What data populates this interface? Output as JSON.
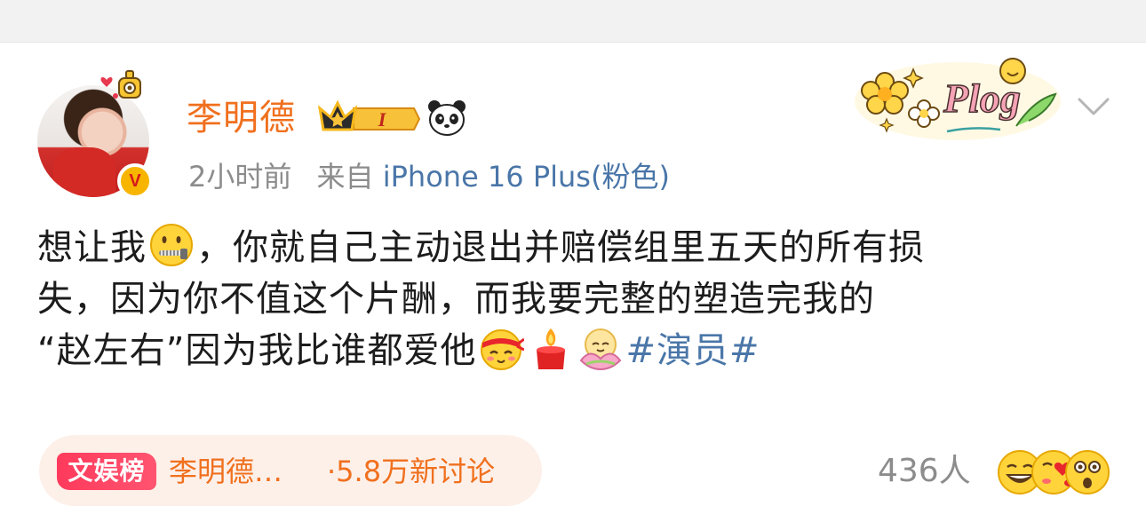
{
  "post": {
    "username": "李明德",
    "member_level": "I",
    "verified_mark": "V",
    "time": "2小时前",
    "source_prefix": "来自",
    "source_device": "iPhone 16 Plus(粉色)",
    "content_line1_a": "想让我",
    "content_line1_b": "，你就自己主动退出并赔偿组里五天的所有损",
    "content_line2": "失，因为你不值这个片酬，而我要完整的塑造完我的",
    "content_line3_a": "“赵左右”因为我比谁都爱他",
    "topic": "#演员#",
    "sticker_text": "Plog"
  },
  "rank": {
    "tag": "文娱榜",
    "name": "李明德…",
    "count": "·5.8万新讨论"
  },
  "footer": {
    "people": "436人"
  },
  "icons": {
    "avatar_deco": "heart-robot-icon",
    "crown": "crown-icon",
    "panda": "panda-icon",
    "chevron": "chevron-down-icon",
    "emoji_zipper": "zipper-mouth-emoji",
    "emoji_headband": "headband-emoji",
    "emoji_candle": "candle-emoji",
    "emoji_lotus": "lotus-emoji",
    "reactions": [
      "laugh-emoji",
      "heart-kiss-emoji",
      "surprised-emoji"
    ]
  },
  "colors": {
    "username": "#f0701e",
    "link": "#4a76a8",
    "meta": "#8c8c8c",
    "rank_tag": "#ff3a5c",
    "rank_bg": "#fdf0e9"
  }
}
